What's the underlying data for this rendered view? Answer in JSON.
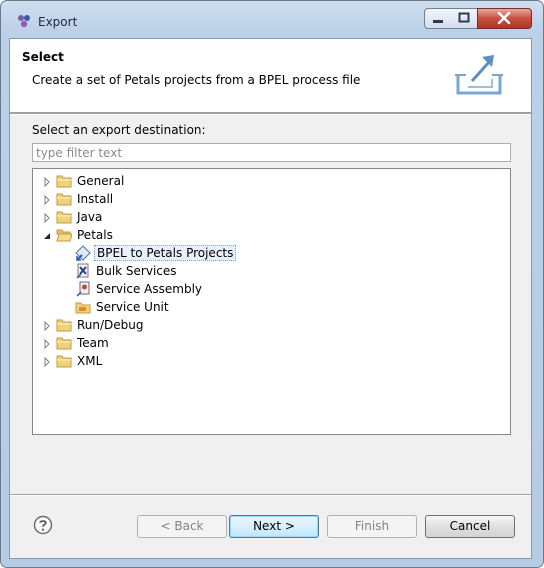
{
  "window": {
    "title": "Export"
  },
  "header": {
    "title": "Select",
    "description": "Create a set of Petals projects from a BPEL process file"
  },
  "destination_label": "Select an export destination:",
  "filter": {
    "value": "",
    "placeholder": "type filter text"
  },
  "tree": {
    "items": [
      {
        "label": "General",
        "expanded": false,
        "icon": "folder-icon"
      },
      {
        "label": "Install",
        "expanded": false,
        "icon": "folder-icon"
      },
      {
        "label": "Java",
        "expanded": false,
        "icon": "folder-icon"
      },
      {
        "label": "Petals",
        "expanded": true,
        "icon": "folder-open-icon",
        "children": [
          {
            "label": "BPEL to Petals Projects",
            "selected": true,
            "icon": "bpel-icon"
          },
          {
            "label": "Bulk Services",
            "icon": "bulk-services-icon"
          },
          {
            "label": "Service Assembly",
            "icon": "service-assembly-icon"
          },
          {
            "label": "Service Unit",
            "icon": "service-unit-icon"
          }
        ]
      },
      {
        "label": "Run/Debug",
        "expanded": false,
        "icon": "folder-icon"
      },
      {
        "label": "Team",
        "expanded": false,
        "icon": "folder-icon"
      },
      {
        "label": "XML",
        "expanded": false,
        "icon": "folder-icon"
      }
    ]
  },
  "buttons": {
    "back": "< Back",
    "next": "Next >",
    "finish": "Finish",
    "cancel": "Cancel"
  },
  "colors": {
    "titlebar": "#bcd0e7",
    "dialog_bg": "#f0f0f0",
    "close_button": "#c75040",
    "default_button_border": "#3c7fb1"
  }
}
